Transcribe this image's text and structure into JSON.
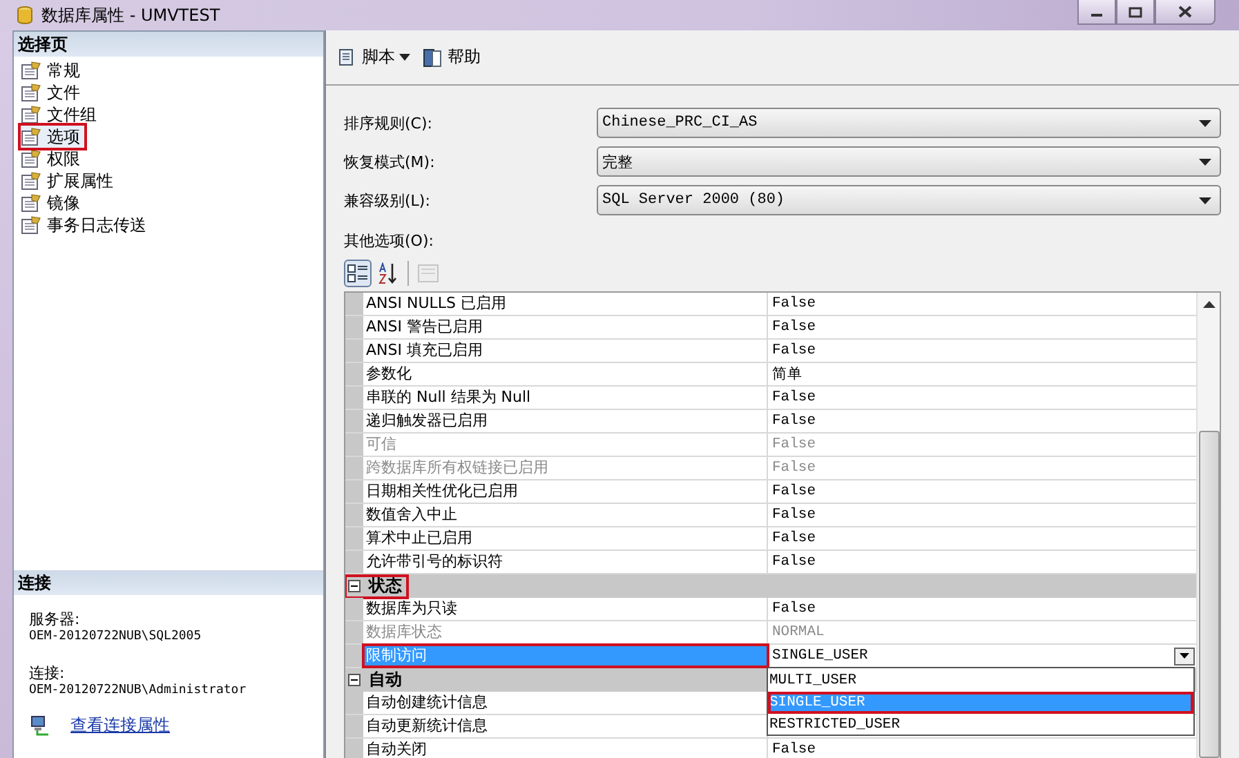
{
  "window": {
    "title": "数据库属性 - UMVTEST"
  },
  "sidebar": {
    "header": "选择页",
    "items": [
      {
        "label": "常规",
        "selected": false,
        "annotated": false
      },
      {
        "label": "文件",
        "selected": false,
        "annotated": false
      },
      {
        "label": "文件组",
        "selected": false,
        "annotated": false
      },
      {
        "label": "选项",
        "selected": true,
        "annotated": true
      },
      {
        "label": "权限",
        "selected": false,
        "annotated": false
      },
      {
        "label": "扩展属性",
        "selected": false,
        "annotated": false
      },
      {
        "label": "镜像",
        "selected": false,
        "annotated": false
      },
      {
        "label": "事务日志传送",
        "selected": false,
        "annotated": false
      }
    ],
    "connection": {
      "header": "连接",
      "fields": [
        {
          "label": "服务器:",
          "value": "OEM-20120722NUB\\SQL2005"
        },
        {
          "label": "连接:",
          "value": "OEM-20120722NUB\\Administrator"
        }
      ],
      "link": "查看连接属性"
    }
  },
  "toolbar": [
    {
      "kind": "script",
      "label": "脚本"
    },
    {
      "kind": "help",
      "label": "帮助"
    }
  ],
  "form": [
    {
      "label": "排序规则(C):",
      "value": "Chinese_PRC_CI_AS"
    },
    {
      "label": "恢复模式(M):",
      "value": "完整"
    },
    {
      "label": "兼容级别(L):",
      "value": "SQL Server 2000 (80)"
    }
  ],
  "other_options_label": "其他选项(O):",
  "grid": {
    "rows": [
      {
        "kind": "property",
        "name": "ANSI NULLS 已启用",
        "value": "False",
        "disabled": false,
        "selected": false
      },
      {
        "kind": "property",
        "name": "ANSI 警告已启用",
        "value": "False",
        "disabled": false,
        "selected": false
      },
      {
        "kind": "property",
        "name": "ANSI 填充已启用",
        "value": "False",
        "disabled": false,
        "selected": false
      },
      {
        "kind": "property",
        "name": "参数化",
        "value": "简单",
        "disabled": false,
        "selected": false
      },
      {
        "kind": "property",
        "name": "串联的 Null 结果为 Null",
        "value": "False",
        "disabled": false,
        "selected": false
      },
      {
        "kind": "property",
        "name": "递归触发器已启用",
        "value": "False",
        "disabled": false,
        "selected": false
      },
      {
        "kind": "property",
        "name": "可信",
        "value": "False",
        "disabled": true,
        "selected": false
      },
      {
        "kind": "property",
        "name": "跨数据库所有权链接已启用",
        "value": "False",
        "disabled": true,
        "selected": false
      },
      {
        "kind": "property",
        "name": "日期相关性优化已启用",
        "value": "False",
        "disabled": false,
        "selected": false
      },
      {
        "kind": "property",
        "name": "数值舍入中止",
        "value": "False",
        "disabled": false,
        "selected": false
      },
      {
        "kind": "property",
        "name": "算术中止已启用",
        "value": "False",
        "disabled": false,
        "selected": false
      },
      {
        "kind": "property",
        "name": "允许带引号的标识符",
        "value": "False",
        "disabled": false,
        "selected": false
      },
      {
        "kind": "category",
        "name": "状态",
        "expanded": true,
        "annotated": true
      },
      {
        "kind": "property",
        "name": "数据库为只读",
        "value": "False",
        "disabled": false,
        "selected": false
      },
      {
        "kind": "property",
        "name": "数据库状态",
        "value": "NORMAL",
        "disabled": true,
        "selected": false
      },
      {
        "kind": "property",
        "name": "限制访问",
        "value": "SINGLE_USER",
        "disabled": false,
        "selected": true,
        "annotated": true,
        "dropdown": {
          "options": [
            {
              "label": "MULTI_USER",
              "selected": false,
              "annotated": false
            },
            {
              "label": "SINGLE_USER",
              "selected": true,
              "annotated": true
            },
            {
              "label": "RESTRICTED_USER",
              "selected": false,
              "annotated": false
            }
          ]
        }
      },
      {
        "kind": "category",
        "name": "自动",
        "expanded": true,
        "annotated": false
      },
      {
        "kind": "property",
        "name": "自动创建统计信息",
        "disabled": false,
        "selected": false
      },
      {
        "kind": "property",
        "name": "自动更新统计信息",
        "disabled": false,
        "selected": false
      },
      {
        "kind": "property",
        "name": "自动关闭",
        "value": "False",
        "disabled": false,
        "selected": false
      }
    ]
  }
}
